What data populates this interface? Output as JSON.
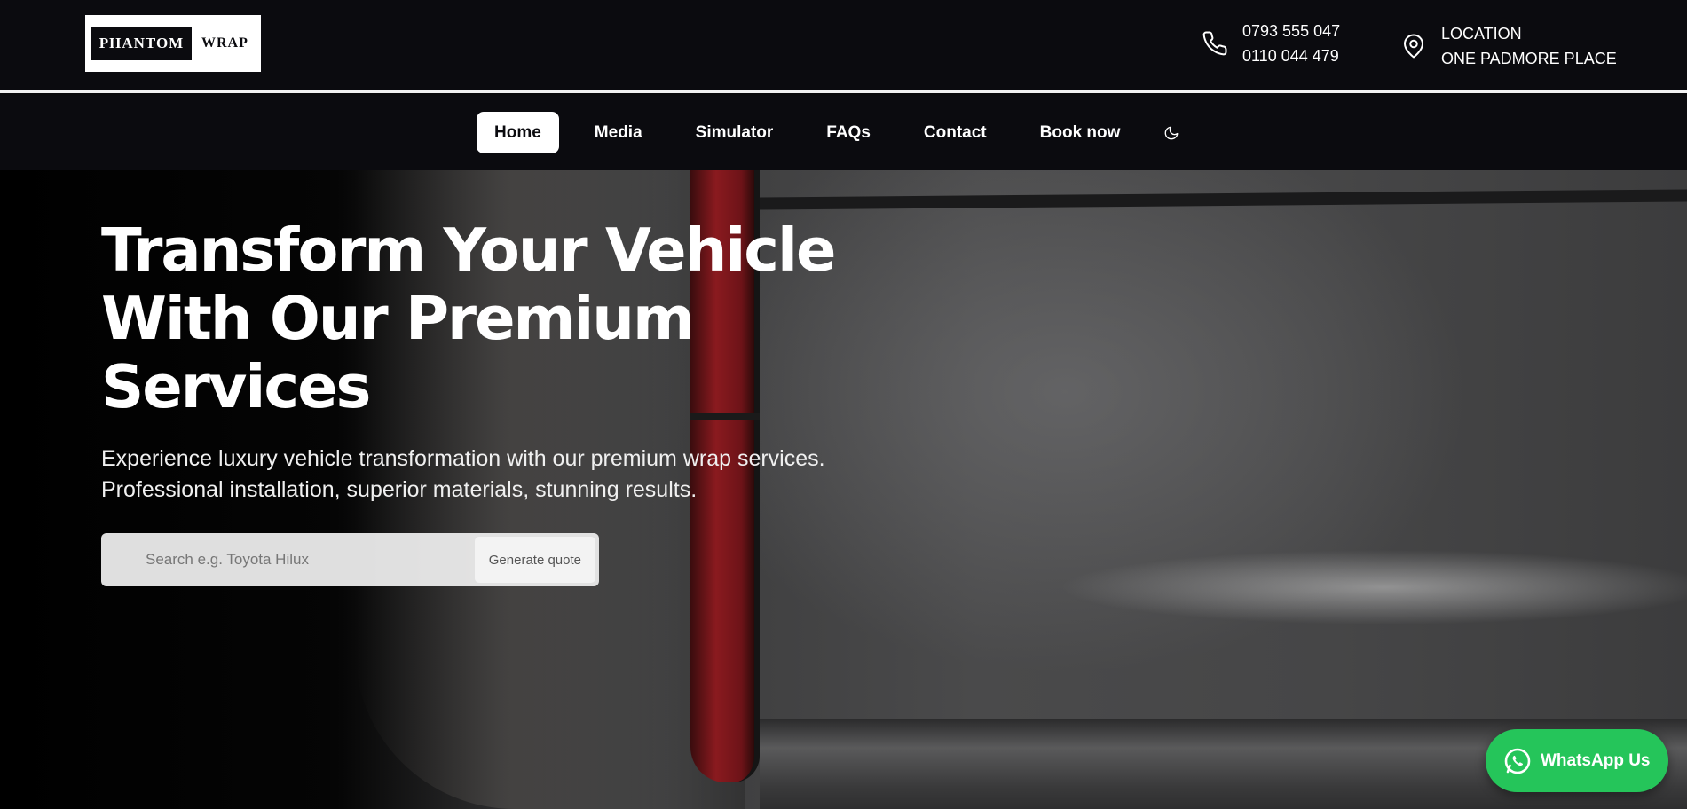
{
  "brand": {
    "logo_left": "PHANTOM",
    "logo_right": "WRAP"
  },
  "contact": {
    "phones": [
      "0793 555 047",
      "0110 044 479"
    ],
    "location_label": "LOCATION",
    "location_value": "ONE PADMORE PLACE"
  },
  "nav": {
    "items": [
      {
        "label": "Home",
        "active": true
      },
      {
        "label": "Media"
      },
      {
        "label": "Simulator"
      },
      {
        "label": "FAQs"
      },
      {
        "label": "Contact"
      },
      {
        "label": "Book now"
      }
    ],
    "theme_icon": "moon-icon"
  },
  "hero": {
    "title_line1": "Transform Your Vehicle",
    "title_line2": "With Our Premium",
    "title_line3": "Services",
    "subtitle": "Experience luxury vehicle transformation with our premium wrap services. Professional installation, superior materials, stunning results.",
    "search_placeholder": "Search e.g. Toyota Hilux",
    "search_button": "Generate quote"
  },
  "whatsapp": {
    "label": "WhatsApp Us",
    "color": "#25c55a"
  }
}
